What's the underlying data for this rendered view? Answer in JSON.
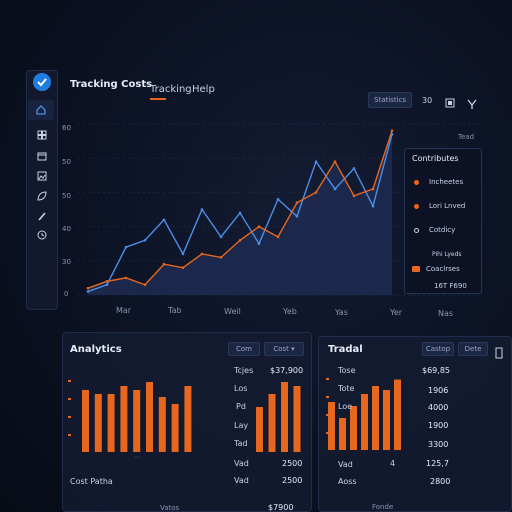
{
  "app": {
    "title": "Tracking Costs"
  },
  "nav": {
    "tabs": [
      {
        "label": "Tracking"
      },
      {
        "label": "Help"
      }
    ]
  },
  "toolbar": {
    "select_label": "Statistics",
    "pager": "30"
  },
  "sidebar": {
    "icons": [
      "home-icon",
      "grid-icon",
      "calendar-icon",
      "image-icon",
      "leaf-icon",
      "pen-icon",
      "clock-icon"
    ]
  },
  "main_chart": {
    "ytick_labels": [
      "60",
      "50",
      "40",
      "30",
      "0"
    ],
    "xtick_labels": [
      "Mar",
      "Tab",
      "Weil",
      "Yeb",
      "Yas",
      "Yer",
      "Nas"
    ],
    "corner_label": "Tead",
    "legend": {
      "title": "Contributes",
      "items": [
        {
          "label": "Incheetes",
          "color": "#e8671f"
        },
        {
          "label": "Lori Lnved",
          "color": "#e8671f"
        },
        {
          "label": "Cotdicy",
          "color": "#4a90e2"
        },
        {
          "label": "Pihi Lyeds",
          "color": ""
        },
        {
          "label": "Coaclrses",
          "color": "#e8671f"
        }
      ],
      "footer": "16T F690"
    }
  },
  "colors": {
    "orange": "#e8671f",
    "blue": "#4a8fe8",
    "area": "#1e2a4f"
  },
  "analytics_panel": {
    "title": "Analytics",
    "btn1": "Com",
    "btn2": "Cost",
    "row_labels": [
      "Tcjes",
      "Los",
      "Pd",
      "Lay",
      "Tad",
      "Vad"
    ],
    "row_values": [
      "$37,900",
      "",
      "",
      "",
      "",
      "2500"
    ],
    "footer_left": "Cost Patha",
    "footer_right": "$7900",
    "footer_right2": "2500",
    "footer_mid": "Vatos"
  },
  "trend_panel": {
    "title": "Tradal",
    "btn1": "Castop",
    "btn2": "Dete",
    "row_labels": [
      "Tose",
      "Tote",
      "Loe",
      "Vad",
      "Aoss"
    ],
    "row_values": [
      "$69,85",
      "1906",
      "4000",
      "1900",
      "3300",
      "125,7",
      "2800"
    ],
    "row_mid": "4",
    "footer_mid": "Fonde"
  },
  "chart_data": [
    {
      "type": "line",
      "x": [
        "Mar",
        "Tab",
        "Weil",
        "Yeb",
        "Yas",
        "Yer",
        "Nas"
      ],
      "series": [
        {
          "values": [
            2,
            4,
            5,
            3,
            9,
            8,
            12,
            11,
            16,
            20,
            17,
            27,
            30,
            39,
            29,
            31,
            48
          ]
        },
        {
          "values": [
            1,
            3,
            14,
            16,
            22,
            12,
            25,
            17,
            24,
            15,
            28,
            23,
            39,
            31,
            37,
            26,
            47
          ]
        }
      ],
      "ylim": [
        0,
        50
      ]
    },
    {
      "type": "bar",
      "categories": [
        "1",
        "2",
        "3",
        "4",
        "5",
        "6",
        "7",
        "8",
        "9"
      ],
      "series": [
        {
          "values": [
            62,
            58,
            58,
            66,
            62,
            70,
            55,
            48,
            66
          ]
        },
        {
          "values": [
            45,
            58,
            70,
            66
          ]
        }
      ],
      "ylim": [
        0,
        80
      ]
    },
    {
      "type": "bar",
      "categories": [
        "1",
        "2",
        "3",
        "4",
        "5",
        "6",
        "7"
      ],
      "series": [
        {
          "values": [
            60,
            40,
            55,
            70,
            80,
            75,
            88
          ]
        }
      ],
      "ylim": [
        0,
        100
      ]
    }
  ]
}
